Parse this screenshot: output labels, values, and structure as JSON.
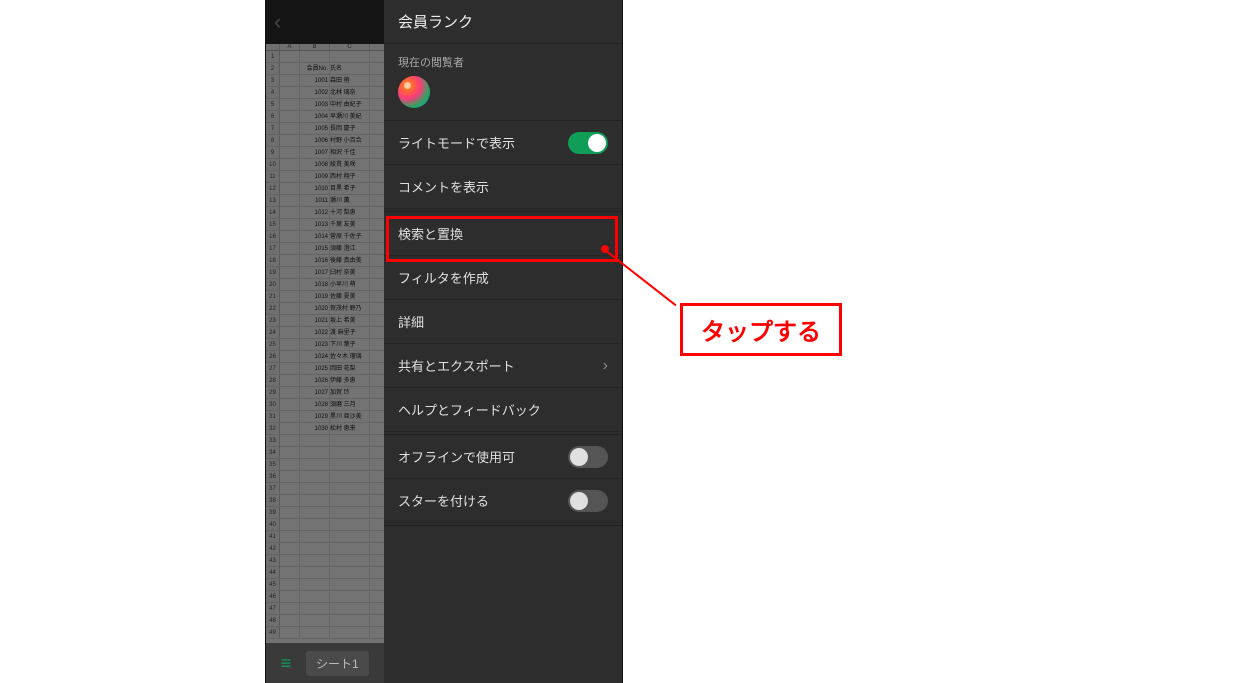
{
  "panel": {
    "title": "会員ランク",
    "viewers_label": "現在の閲覧者",
    "items": {
      "light_mode": "ライトモードで表示",
      "show_comments": "コメントを表示",
      "find_replace": "検索と置換",
      "create_filter": "フィルタを作成",
      "details": "詳細",
      "share_export": "共有とエクスポート",
      "help_feedback": "ヘルプとフィードバック",
      "offline": "オフラインで使用可",
      "star": "スターを付ける"
    },
    "toggles": {
      "light_mode": true,
      "offline": false,
      "star": false
    }
  },
  "sheet": {
    "tab_name": "シート1",
    "columns": [
      "A",
      "B",
      "C"
    ],
    "header_row": {
      "b": "会員No.",
      "c": "氏名"
    },
    "rows": [
      {
        "n": 1,
        "a": "",
        "b": "",
        "c": ""
      },
      {
        "n": 2,
        "a": "",
        "b": "会員No.",
        "c": "氏名"
      },
      {
        "n": 3,
        "a": "",
        "b": "1001",
        "c": "森田 梢"
      },
      {
        "n": 4,
        "a": "",
        "b": "1002",
        "c": "北林 璃奈"
      },
      {
        "n": 5,
        "a": "",
        "b": "1003",
        "c": "中村 由紀子"
      },
      {
        "n": 6,
        "a": "",
        "b": "1004",
        "c": "早瀬川 美紀"
      },
      {
        "n": 7,
        "a": "",
        "b": "1005",
        "c": "長岡 慶子"
      },
      {
        "n": 8,
        "a": "",
        "b": "1006",
        "c": "村野 小百合"
      },
      {
        "n": 9,
        "a": "",
        "b": "1007",
        "c": "相沢 千佳"
      },
      {
        "n": 10,
        "a": "",
        "b": "1008",
        "c": "綾貫 美咲"
      },
      {
        "n": 11,
        "a": "",
        "b": "1009",
        "c": "西村 翔子"
      },
      {
        "n": 12,
        "a": "",
        "b": "1010",
        "c": "目黒 希子"
      },
      {
        "n": 13,
        "a": "",
        "b": "1011",
        "c": "瀬川 薫"
      },
      {
        "n": 14,
        "a": "",
        "b": "1012",
        "c": "十河 梨恵"
      },
      {
        "n": 15,
        "a": "",
        "b": "1013",
        "c": "千葉 友美"
      },
      {
        "n": 16,
        "a": "",
        "b": "1014",
        "c": "菅原 千佐子"
      },
      {
        "n": 17,
        "a": "",
        "b": "1015",
        "c": "須藤 澄江"
      },
      {
        "n": 18,
        "a": "",
        "b": "1016",
        "c": "後藤 真由美"
      },
      {
        "n": 19,
        "a": "",
        "b": "1017",
        "c": "臼村 奈美"
      },
      {
        "n": 20,
        "a": "",
        "b": "1018",
        "c": "小早川 萌"
      },
      {
        "n": 21,
        "a": "",
        "b": "1019",
        "c": "佐藤 夏美"
      },
      {
        "n": 22,
        "a": "",
        "b": "1020",
        "c": "賀茂村 野乃"
      },
      {
        "n": 23,
        "a": "",
        "b": "1021",
        "c": "坂上 希美"
      },
      {
        "n": 24,
        "a": "",
        "b": "1022",
        "c": "渡 麻里子"
      },
      {
        "n": 25,
        "a": "",
        "b": "1023",
        "c": "下川 葉子"
      },
      {
        "n": 26,
        "a": "",
        "b": "1024",
        "c": "佐々木 瑠璃"
      },
      {
        "n": 27,
        "a": "",
        "b": "1025",
        "c": "岡田 花梨"
      },
      {
        "n": 28,
        "a": "",
        "b": "1026",
        "c": "伊藤 多恵"
      },
      {
        "n": 29,
        "a": "",
        "b": "1027",
        "c": "加賀 玲"
      },
      {
        "n": 30,
        "a": "",
        "b": "1028",
        "c": "須磨 三月"
      },
      {
        "n": 31,
        "a": "",
        "b": "1029",
        "c": "黒川 亜沙美"
      },
      {
        "n": 32,
        "a": "",
        "b": "1030",
        "c": "松村 恵来"
      },
      {
        "n": 33,
        "a": "",
        "b": "",
        "c": ""
      },
      {
        "n": 34,
        "a": "",
        "b": "",
        "c": ""
      },
      {
        "n": 35,
        "a": "",
        "b": "",
        "c": ""
      },
      {
        "n": 36,
        "a": "",
        "b": "",
        "c": ""
      },
      {
        "n": 37,
        "a": "",
        "b": "",
        "c": ""
      },
      {
        "n": 38,
        "a": "",
        "b": "",
        "c": ""
      },
      {
        "n": 39,
        "a": "",
        "b": "",
        "c": ""
      },
      {
        "n": 40,
        "a": "",
        "b": "",
        "c": ""
      },
      {
        "n": 41,
        "a": "",
        "b": "",
        "c": ""
      },
      {
        "n": 42,
        "a": "",
        "b": "",
        "c": ""
      },
      {
        "n": 43,
        "a": "",
        "b": "",
        "c": ""
      },
      {
        "n": 44,
        "a": "",
        "b": "",
        "c": ""
      },
      {
        "n": 45,
        "a": "",
        "b": "",
        "c": ""
      },
      {
        "n": 46,
        "a": "",
        "b": "",
        "c": ""
      },
      {
        "n": 47,
        "a": "",
        "b": "",
        "c": ""
      },
      {
        "n": 48,
        "a": "",
        "b": "",
        "c": ""
      },
      {
        "n": 49,
        "a": "",
        "b": "",
        "c": ""
      }
    ]
  },
  "annotation": {
    "label": "タップする"
  }
}
